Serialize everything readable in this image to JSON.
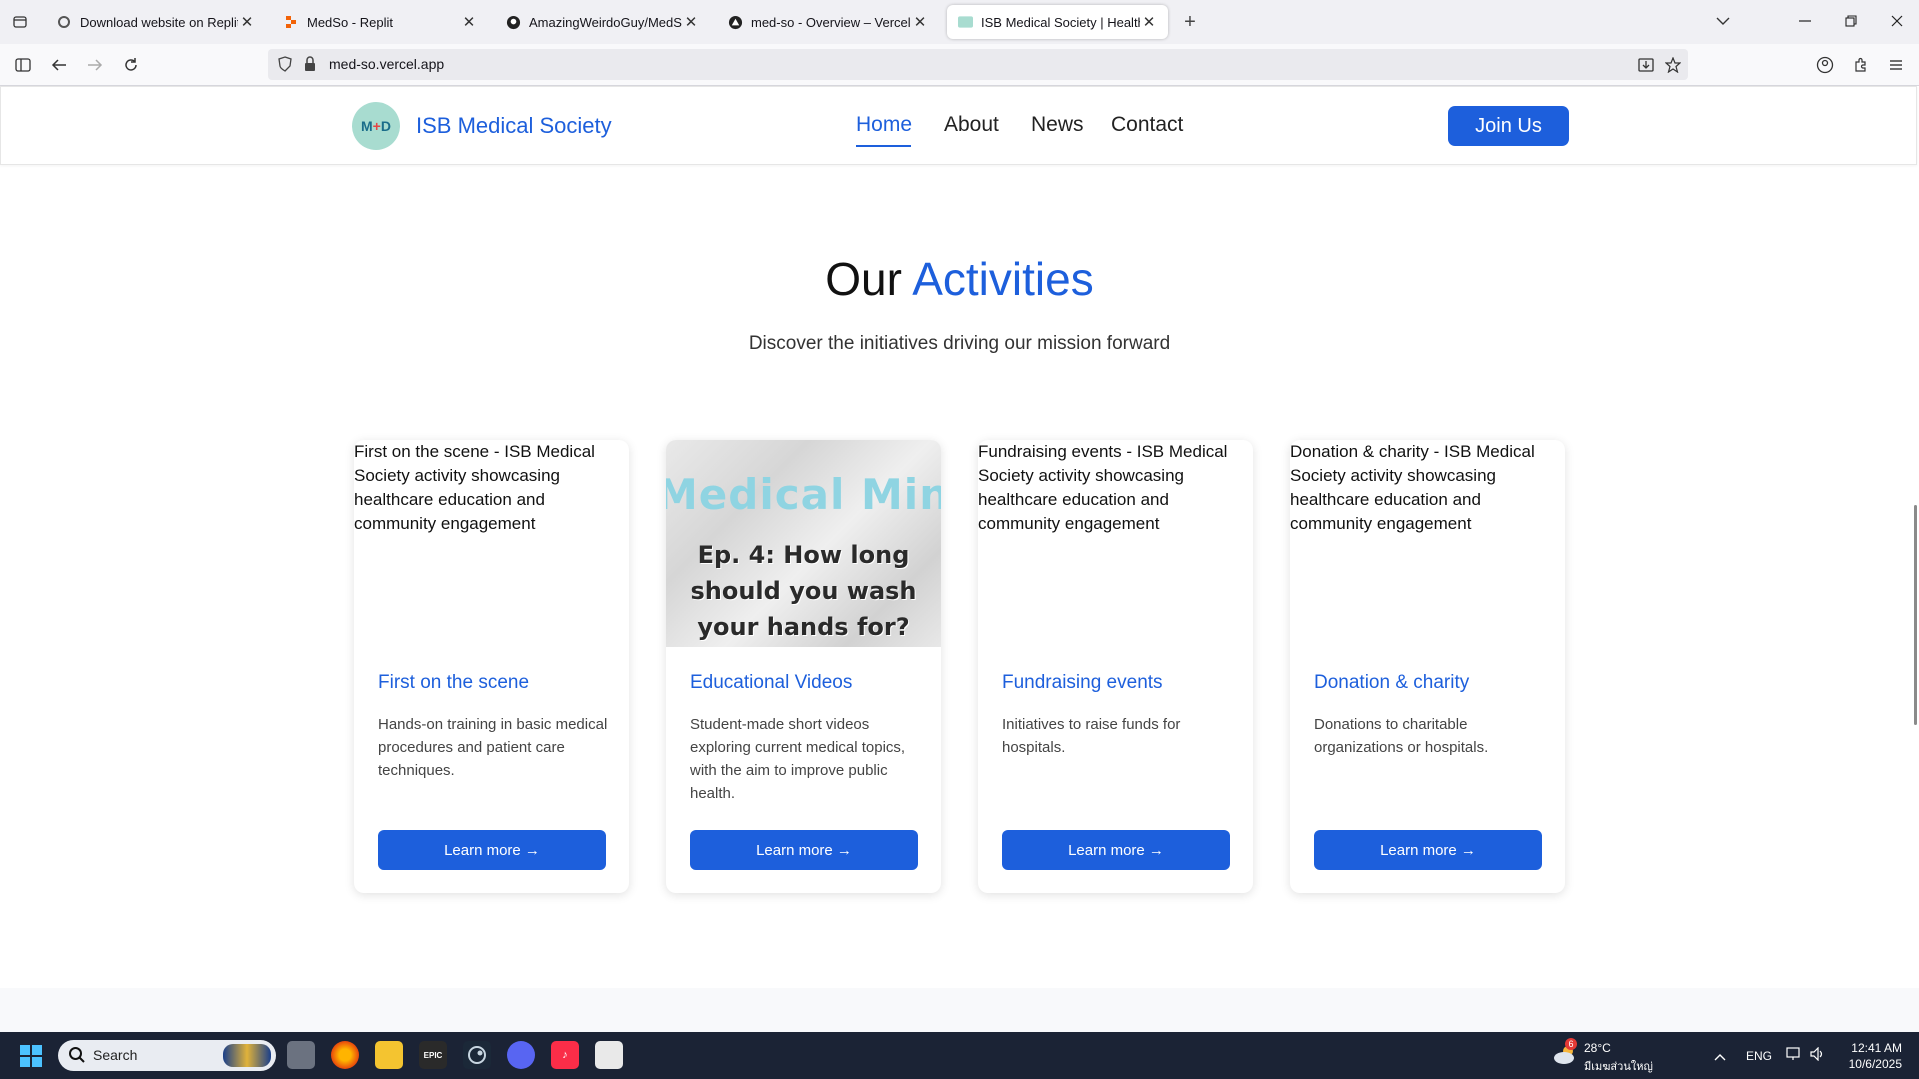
{
  "browser": {
    "tabs": [
      {
        "title": "Download website on Replit",
        "favicon": "replit-gear-icon",
        "active": false
      },
      {
        "title": "MedSo - Replit",
        "favicon": "replit-icon",
        "active": false
      },
      {
        "title": "AmazingWeirdoGuy/MedSo",
        "favicon": "github-icon",
        "active": false
      },
      {
        "title": "med-so - Overview – Vercel",
        "favicon": "vercel-icon",
        "active": false
      },
      {
        "title": "ISB Medical Society | Healthcare",
        "favicon": "site-icon",
        "active": true
      }
    ],
    "url": "med-so.vercel.app"
  },
  "site": {
    "logo_text": "M",
    "logo_plus": "+",
    "logo_text2": "D",
    "brand": "ISB Medical Society",
    "nav": [
      "Home",
      "About",
      "News",
      "Contact"
    ],
    "active_nav": "Home",
    "join_label": "Join Us"
  },
  "activities": {
    "heading_plain": "Our",
    "heading_accent": "Activities",
    "subheading": "Discover the initiatives driving our mission forward",
    "cards": [
      {
        "image_alt": "First on the scene - ISB Medical Society activity showcasing healthcare education and community engagement",
        "title": "First on the scene",
        "description": "Hands-on training in basic medical procedures and patient care techniques.",
        "button": "Learn more →"
      },
      {
        "thumb_line1": "Medical Minute",
        "thumb_line2": "Ep. 4: How long should you wash your hands for?",
        "title": "Educational Videos",
        "description": "Student-made short videos exploring current medical topics, with the aim to improve public health.",
        "button": "Learn more →"
      },
      {
        "image_alt": "Fundraising events - ISB Medical Society activity showcasing healthcare education and community engagement",
        "title": "Fundraising events",
        "description": "Initiatives to raise funds for hospitals.",
        "button": "Learn more →"
      },
      {
        "image_alt": "Donation & charity - ISB Medical Society activity showcasing healthcare education and community engagement",
        "title": "Donation & charity",
        "description": "Donations to charitable organizations or hospitals.",
        "button": "Learn more →"
      }
    ]
  },
  "taskbar": {
    "search_placeholder": "Search",
    "weather_badge": "6",
    "weather_temp": "28°C",
    "weather_desc": "มีเมฆส่วนใหญ่",
    "lang": "ENG",
    "time": "12:41 AM",
    "date": "10/6/2025",
    "apps": [
      "task-view-icon",
      "firefox-icon",
      "file-explorer-icon",
      "epic-games-icon",
      "steam-icon",
      "discord-icon",
      "apple-music-icon",
      "app-icon"
    ]
  },
  "colors": {
    "accent": "#1d5fdc",
    "taskbar": "#1b2335"
  }
}
